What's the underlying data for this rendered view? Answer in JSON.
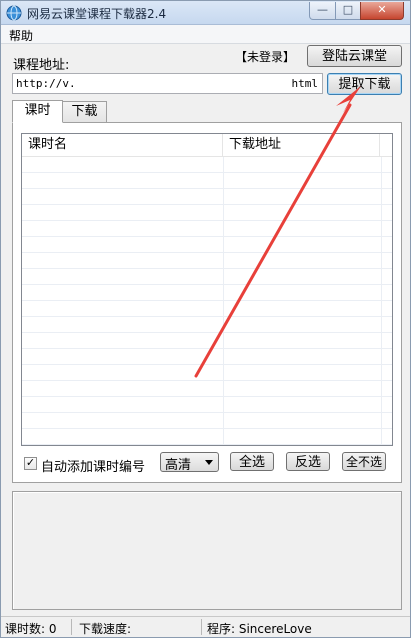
{
  "window": {
    "title": "网易云课堂课程下载器2.4",
    "minimize_glyph": "—",
    "maximize_glyph": "□",
    "close_glyph": "✕"
  },
  "menu": {
    "items": [
      {
        "label": "帮助"
      }
    ]
  },
  "top": {
    "course_url_label": "课程地址:",
    "login_status": "【未登录】",
    "login_button": "登陆云课堂",
    "url_input": {
      "value_start": "http://v.",
      "value_end": "html"
    },
    "extract_button": "提取下载"
  },
  "tabs": [
    {
      "label": "课时",
      "active": true
    },
    {
      "label": "下载",
      "active": false
    }
  ],
  "list": {
    "columns": [
      {
        "label": "课时名"
      },
      {
        "label": "下载地址"
      }
    ],
    "rows": []
  },
  "controls": {
    "auto_number_label": "自动添加课时编号",
    "auto_number_checked": true,
    "check_glyph": "✓",
    "quality_selected": "高清",
    "select_all": "全选",
    "invert_selection": "反选",
    "select_none": "全不选"
  },
  "status": {
    "lesson_count": "课时数: 0",
    "download_speed": "下载速度:",
    "program": "程序: SincereLove"
  },
  "colors": {
    "annotation_arrow": "#e8403a",
    "title_bar": "#c6d8ef"
  },
  "icons": {
    "app_icon": "globe-icon",
    "quality_dropdown": "chevron-down-icon"
  }
}
